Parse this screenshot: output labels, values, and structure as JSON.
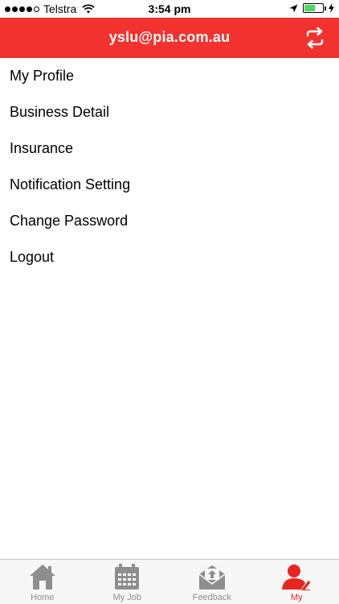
{
  "status_bar": {
    "carrier": "Telstra",
    "time": "3:54 pm",
    "signal_bars_filled": 4,
    "signal_bars_total": 5,
    "battery_level": 0.55
  },
  "header": {
    "title": "yslu@pia.com.au",
    "refresh_icon": "refresh-icon",
    "background_color": "#f2322f"
  },
  "menu": {
    "items": [
      {
        "label": "My Profile"
      },
      {
        "label": "Business Detail"
      },
      {
        "label": "Insurance"
      },
      {
        "label": "Notification Setting"
      },
      {
        "label": "Change Password"
      },
      {
        "label": "Logout"
      }
    ]
  },
  "tab_bar": {
    "active": "My",
    "active_color": "#e8251f",
    "inactive_color": "#8e8e8e",
    "tabs": [
      {
        "label": "Home",
        "icon": "home-icon"
      },
      {
        "label": "My Job",
        "icon": "calendar-icon"
      },
      {
        "label": "Feedback",
        "icon": "envelope-upload-icon"
      },
      {
        "label": "My",
        "icon": "user-edit-icon"
      }
    ]
  }
}
